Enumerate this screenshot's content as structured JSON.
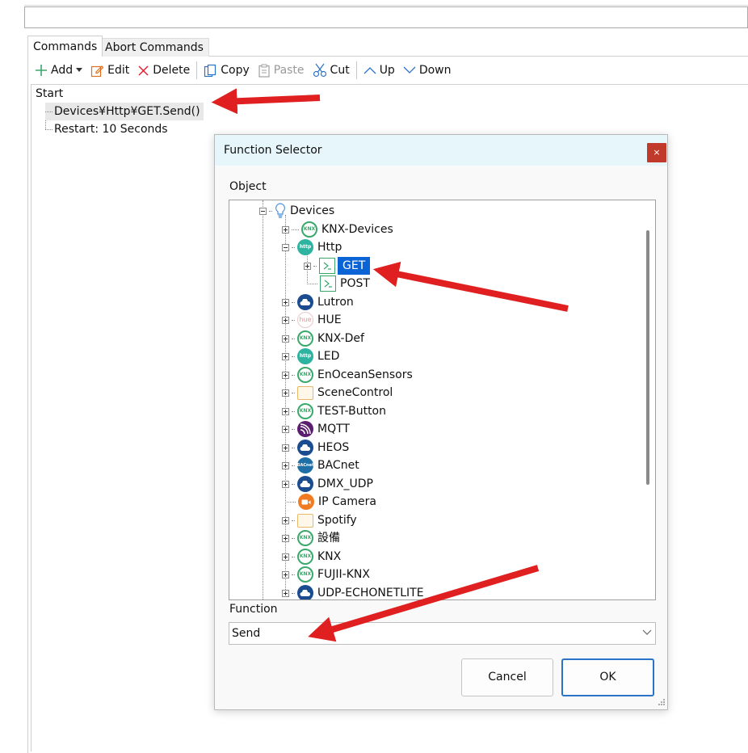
{
  "tabs": [
    {
      "label": "Commands",
      "active": true
    },
    {
      "label": "Abort Commands",
      "active": false
    }
  ],
  "toolbar": {
    "add": "Add",
    "edit": "Edit",
    "delete": "Delete",
    "copy": "Copy",
    "paste": "Paste",
    "cut": "Cut",
    "up": "Up",
    "down": "Down"
  },
  "commands": {
    "root": "Start",
    "items": [
      "Devices¥Http¥GET.Send()",
      "Restart: 10 Seconds"
    ]
  },
  "dialog": {
    "title": "Function Selector",
    "close": "×",
    "object_label": "Object",
    "function_label": "Function",
    "function_value": "Send",
    "cancel": "Cancel",
    "ok": "OK"
  },
  "tree": {
    "root": {
      "label": "Devices",
      "icon": "lightbulb-icon"
    },
    "http_children": [
      {
        "label": "GET",
        "icon": "function-icon",
        "selected": true
      },
      {
        "label": "POST",
        "icon": "function-icon"
      }
    ],
    "nodes": [
      {
        "label": "KNX-Devices",
        "icon": "knx-icon"
      },
      {
        "label": "Http",
        "icon": "http-icon"
      },
      {
        "label": "Lutron",
        "icon": "cloud-icon"
      },
      {
        "label": "HUE",
        "icon": "hue-icon"
      },
      {
        "label": "KNX-Def",
        "icon": "knx-icon"
      },
      {
        "label": "LED",
        "icon": "http-icon"
      },
      {
        "label": "EnOceanSensors",
        "icon": "knx-icon"
      },
      {
        "label": "SceneControl",
        "icon": "folder-icon"
      },
      {
        "label": "TEST-Button",
        "icon": "knx-icon"
      },
      {
        "label": "MQTT",
        "icon": "mqtt-icon"
      },
      {
        "label": "HEOS",
        "icon": "cloud-icon"
      },
      {
        "label": "BACnet",
        "icon": "bacnet-icon"
      },
      {
        "label": "DMX_UDP",
        "icon": "cloud-icon"
      },
      {
        "label": "IP Camera",
        "icon": "camera-icon"
      },
      {
        "label": "Spotify",
        "icon": "folder-icon"
      },
      {
        "label": "設備",
        "icon": "knx-icon"
      },
      {
        "label": "KNX",
        "icon": "knx-icon"
      },
      {
        "label": "FUJII-KNX",
        "icon": "knx-icon"
      },
      {
        "label": "UDP-ECHONETLITE",
        "icon": "cloud-icon"
      }
    ]
  },
  "icon_text": {
    "knx": "KNX",
    "http": "http",
    "hue": "hue",
    "bacnet": "BACnet"
  },
  "colors": {
    "accent": "#0a64d6",
    "annotation_arrow": "#e02020",
    "close_button": "#c0392b",
    "knx_green": "#3aa86b"
  }
}
